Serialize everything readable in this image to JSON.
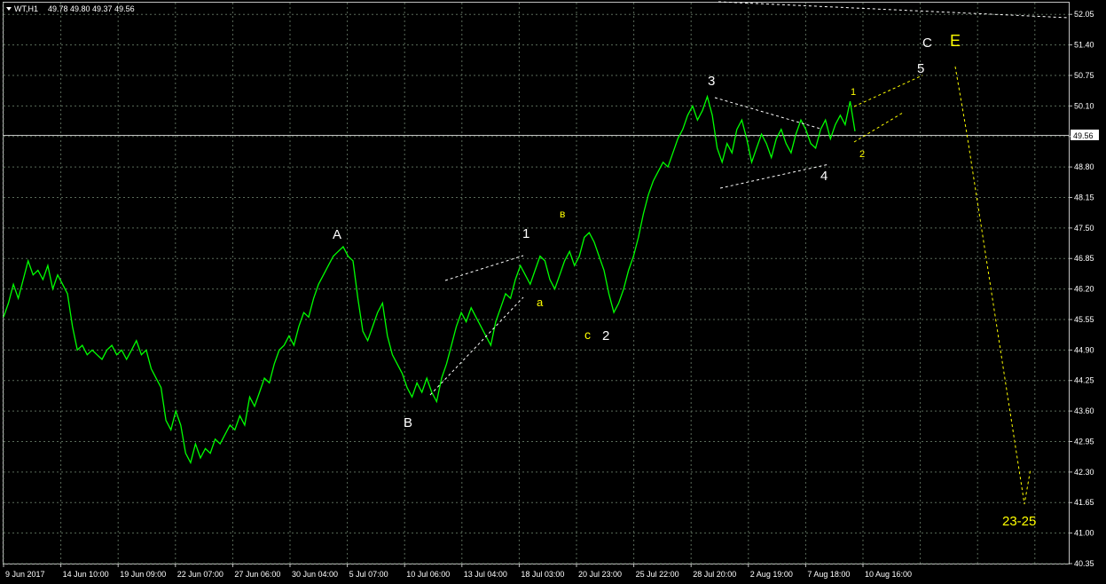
{
  "header": {
    "symbol_timeframe": "WT,H1",
    "ohlc": "49.78 49.80 49.37 49.56"
  },
  "colors": {
    "background": "#000000",
    "grid": "#5a6b5a",
    "price_line": "#00ff00",
    "axis_text": "#ffffff",
    "wave_white": "#ffffff",
    "wave_yellow": "#ffff00",
    "bid_line": "#c0c0c0"
  },
  "current_price_label": "49.56",
  "chart_data": {
    "type": "line",
    "title": "",
    "price_axis_ticks": [
      "52.05",
      "51.40",
      "50.75",
      "50.10",
      "49.45",
      "48.80",
      "48.15",
      "47.50",
      "46.85",
      "46.20",
      "45.55",
      "44.90",
      "44.25",
      "43.60",
      "42.95",
      "42.30",
      "41.65",
      "41.00",
      "40.35"
    ],
    "time_axis_ticks": [
      "9 Jun 2017",
      "14 Jun 10:00",
      "19 Jun 09:00",
      "22 Jun 07:00",
      "27 Jun 06:00",
      "30 Jun 04:00",
      "5 Jul 07:00",
      "10 Jul 06:00",
      "13 Jul 04:00",
      "18 Jul 03:00",
      "20 Jul 23:00",
      "25 Jul 22:00",
      "28 Jul 20:00",
      "2 Aug 19:00",
      "7 Aug 18:00",
      "10 Aug 16:00"
    ],
    "ylim": [
      40.35,
      52.3
    ],
    "grid": true,
    "last_price": 49.56,
    "series": [
      {
        "values": [
          45.6,
          45.9,
          46.3,
          46.0,
          46.4,
          46.8,
          46.5,
          46.6,
          46.4,
          46.7,
          46.2,
          46.5,
          46.3,
          46.1,
          45.4,
          44.9,
          45.0,
          44.8,
          44.9,
          44.8,
          44.7,
          44.9,
          45.0,
          44.8,
          44.9,
          44.7,
          44.9,
          45.1,
          44.8,
          44.9,
          44.5,
          44.3,
          44.1,
          43.4,
          43.2,
          43.6,
          43.3,
          42.7,
          42.5,
          42.9,
          42.6,
          42.8,
          42.7,
          43.0,
          42.9,
          43.1,
          43.3,
          43.2,
          43.5,
          43.3,
          43.9,
          43.7,
          44.0,
          44.3,
          44.2,
          44.6,
          44.9,
          45.0,
          45.2,
          45.0,
          45.4,
          45.7,
          45.6,
          46.0,
          46.3,
          46.5,
          46.7,
          46.9,
          47.0,
          47.1,
          46.9,
          46.8,
          46.0,
          45.3,
          45.1,
          45.4,
          45.7,
          45.9,
          45.2,
          44.8,
          44.6,
          44.4,
          44.1,
          43.9,
          44.2,
          44.0,
          44.3,
          44.0,
          43.8,
          44.3,
          44.6,
          45.0,
          45.4,
          45.7,
          45.5,
          45.8,
          45.6,
          45.4,
          45.2,
          45.0,
          45.5,
          45.8,
          46.1,
          46.0,
          46.4,
          46.7,
          46.5,
          46.3,
          46.6,
          46.9,
          46.8,
          46.4,
          46.2,
          46.5,
          46.8,
          47.0,
          46.7,
          46.9,
          47.3,
          47.4,
          47.2,
          46.9,
          46.6,
          46.1,
          45.7,
          45.9,
          46.2,
          46.6,
          46.9,
          47.3,
          47.8,
          48.2,
          48.5,
          48.7,
          48.9,
          48.8,
          49.1,
          49.4,
          49.6,
          49.9,
          50.1,
          49.8,
          50.0,
          50.3,
          49.9,
          49.2,
          48.9,
          49.3,
          49.1,
          49.6,
          49.8,
          49.4,
          48.9,
          49.2,
          49.5,
          49.3,
          49.0,
          49.4,
          49.6,
          49.3,
          49.1,
          49.5,
          49.8,
          49.6,
          49.3,
          49.2,
          49.6,
          49.8,
          49.4,
          49.7,
          49.9,
          49.7,
          50.2,
          49.56
        ]
      }
    ],
    "annotations_white": [
      "A",
      "B",
      "1",
      "2",
      "3",
      "4",
      "5",
      "C"
    ],
    "annotations_yellow": [
      "в",
      "a",
      "c",
      "1",
      "2",
      "E",
      "23-25"
    ]
  }
}
